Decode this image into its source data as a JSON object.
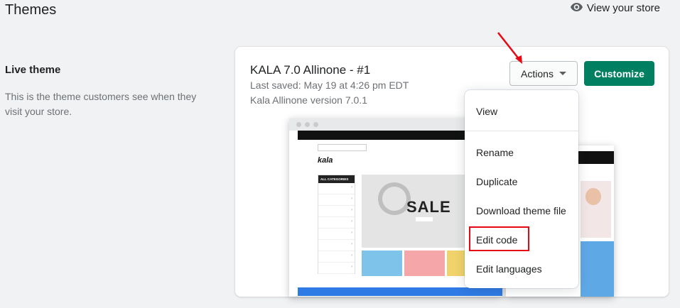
{
  "header": {
    "title": "Themes",
    "view_store_label": "View your store",
    "view_store_icon": "eye-icon"
  },
  "section": {
    "title": "Live theme",
    "description": "This is the theme customers see when they visit your store."
  },
  "theme": {
    "name": "KALA 7.0 Allinone - #1",
    "last_saved": "Last saved: May 19 at 4:26 pm EDT",
    "version": "Kala Allinone version 7.0.1"
  },
  "buttons": {
    "actions_label": "Actions",
    "customize_label": "Customize"
  },
  "actions_menu": {
    "items": [
      "View",
      "Rename",
      "Duplicate",
      "Download theme file",
      "Edit code",
      "Edit languages"
    ],
    "highlighted_item": "Edit code"
  },
  "preview": {
    "logo": "kala",
    "hero_text": "SALE",
    "categories_header": "ALL CATEGORIES"
  },
  "colors": {
    "primary": "#008060",
    "annotation_red": "#e50914",
    "page_bg": "#f1f2f3"
  }
}
